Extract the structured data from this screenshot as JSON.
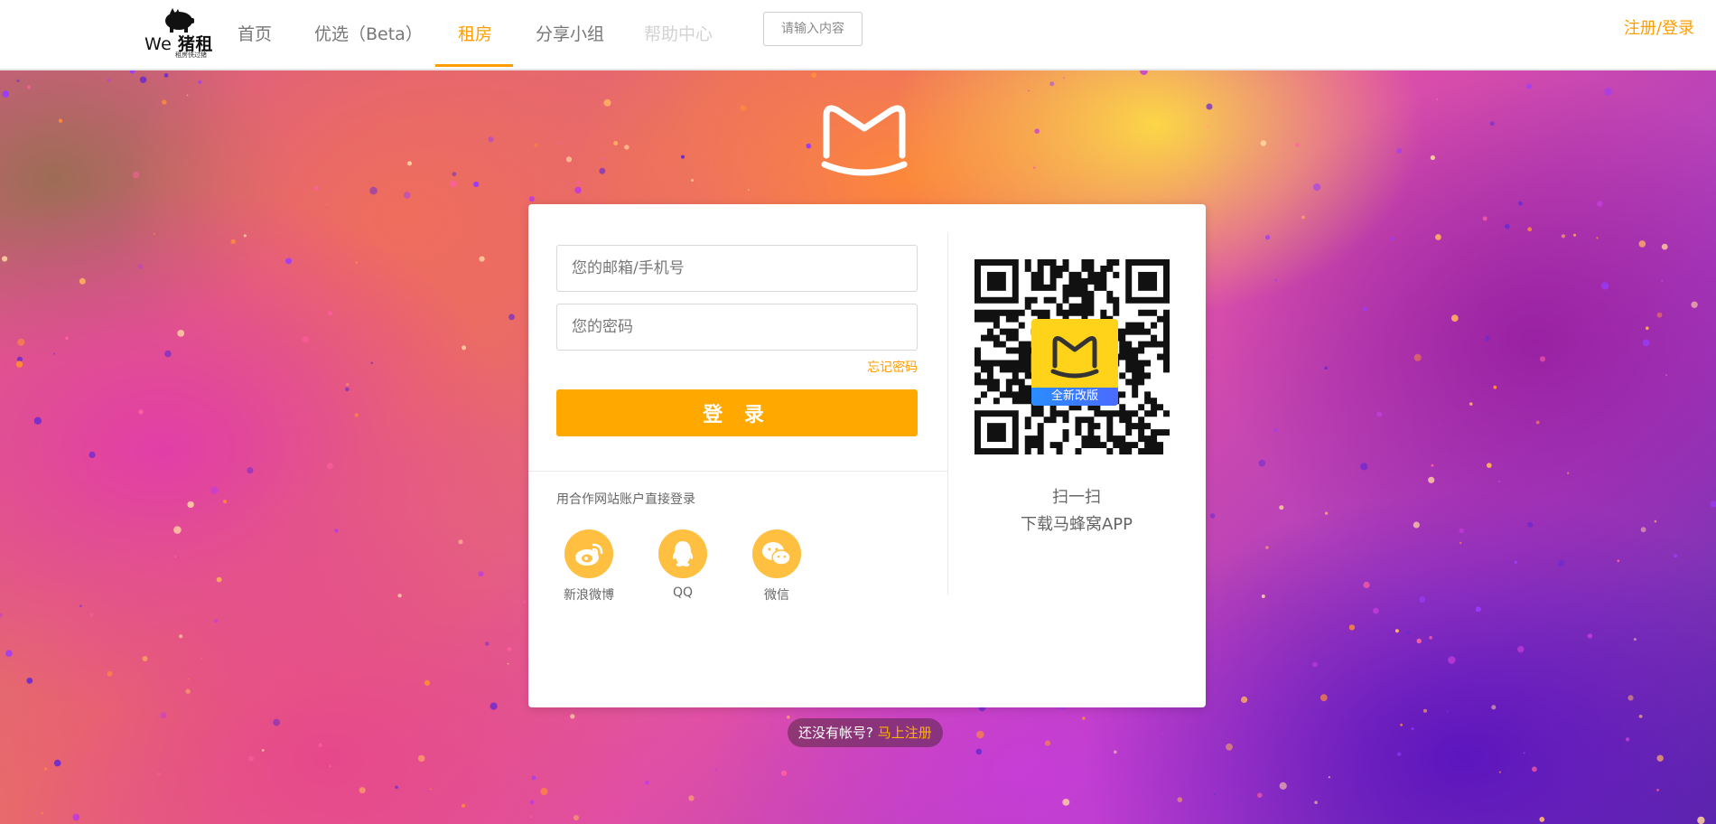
{
  "header": {
    "logo": {
      "brand_prefix": "We",
      "brand_name": "猪租",
      "slogan": "租房快过猪"
    },
    "nav": [
      {
        "label": "首页",
        "state": "normal"
      },
      {
        "label": "优选（Beta）",
        "state": "normal"
      },
      {
        "label": "租房",
        "state": "active"
      },
      {
        "label": "分享小组",
        "state": "normal"
      },
      {
        "label": "帮助中心",
        "state": "disabled"
      }
    ],
    "search": {
      "placeholder": "请输入内容",
      "value": ""
    },
    "login_link": "注册/登录"
  },
  "login": {
    "account": {
      "placeholder": "您的邮箱/手机号",
      "value": ""
    },
    "password": {
      "placeholder": "您的密码",
      "value": ""
    },
    "forgot": "忘记密码",
    "submit": "登 录",
    "partner_label": "用合作网站账户直接登录",
    "partners": [
      {
        "label": "新浪微博",
        "icon": "weibo-icon"
      },
      {
        "label": "QQ",
        "icon": "qq-icon"
      },
      {
        "label": "微信",
        "icon": "wechat-icon"
      }
    ],
    "qr": {
      "badge": "全新改版",
      "line1": "扫一扫",
      "line2": "下载马蜂窝APP"
    }
  },
  "footer": {
    "prompt": "还没有帐号?",
    "register": "马上注册"
  },
  "colors": {
    "accent": "#ff9d00",
    "button": "#ffa800",
    "social": "#ffbf40",
    "badge": "#ffd31a"
  }
}
